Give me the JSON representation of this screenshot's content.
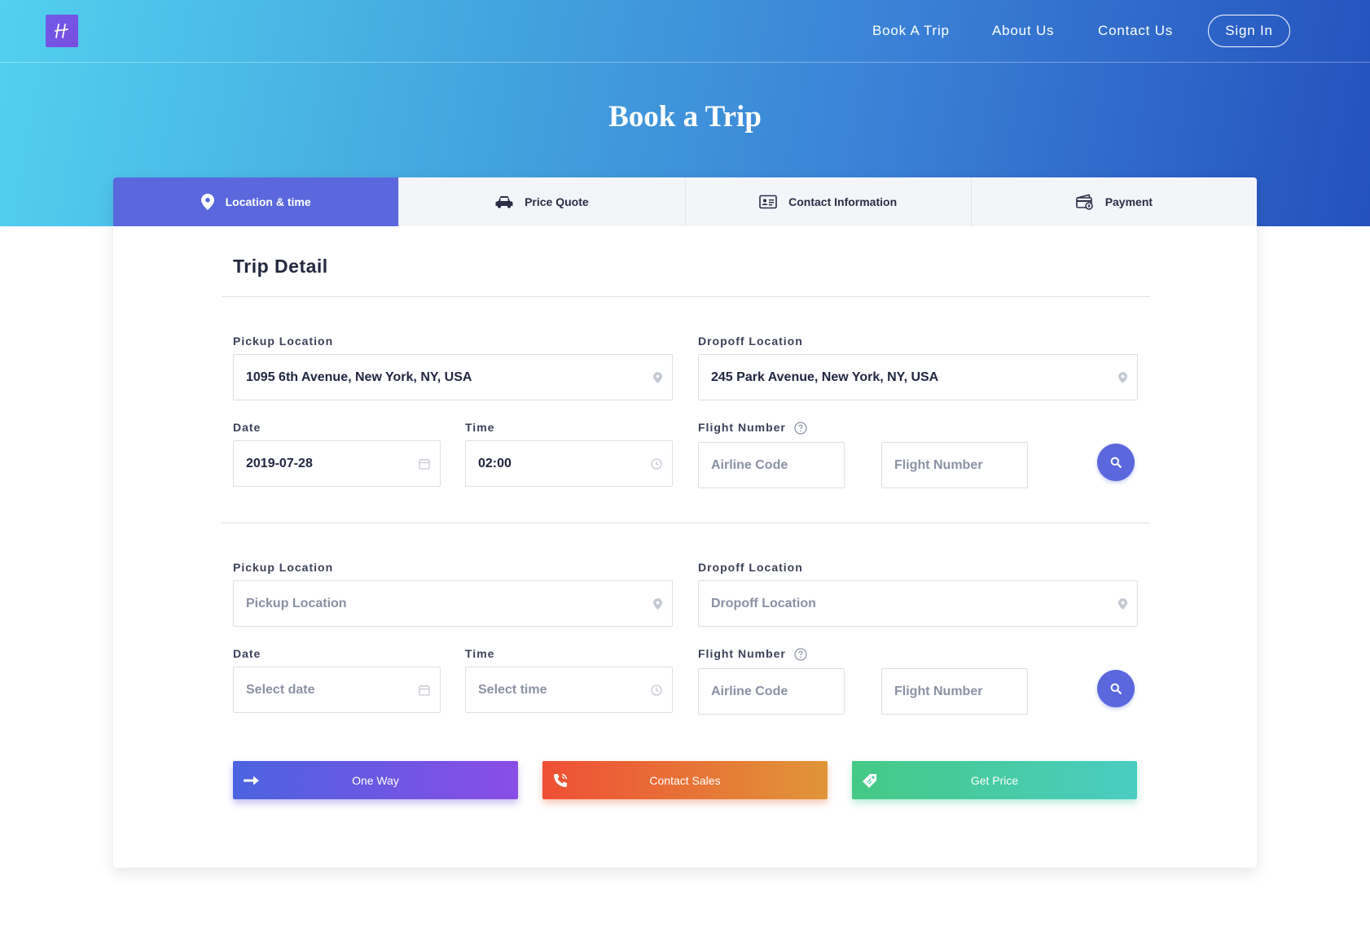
{
  "header": {
    "nav": [
      "Book A Trip",
      "About Us",
      "Contact Us"
    ],
    "sign_in": "Sign In",
    "title": "Book a Trip"
  },
  "tabs": [
    {
      "label": "Location & time",
      "icon": "map-pin-icon",
      "active": true
    },
    {
      "label": "Price Quote",
      "icon": "car-icon",
      "active": false
    },
    {
      "label": "Contact Information",
      "icon": "id-card-icon",
      "active": false
    },
    {
      "label": "Payment",
      "icon": "payment-icon",
      "active": false
    }
  ],
  "trip_detail": {
    "title": "Trip Detail",
    "legs": [
      {
        "pickup_label": "Pickup Location",
        "pickup_value": "1095 6th Avenue, New York, NY, USA",
        "dropoff_label": "Dropoff Location",
        "dropoff_value": "245 Park Avenue, New York, NY, USA",
        "date_label": "Date",
        "date_value": "2019-07-28",
        "time_label": "Time",
        "time_value": "02:00",
        "flight_label": "Flight Number",
        "airline_placeholder": "Airline Code",
        "flight_placeholder": "Flight Number"
      },
      {
        "pickup_label": "Pickup Location",
        "pickup_placeholder": "Pickup Location",
        "dropoff_label": "Dropoff Location",
        "dropoff_placeholder": "Dropoff Location",
        "date_label": "Date",
        "date_placeholder": "Select date",
        "time_label": "Time",
        "time_placeholder": "Select time",
        "flight_label": "Flight Number",
        "airline_placeholder": "Airline Code",
        "flight_placeholder": "Flight Number"
      }
    ]
  },
  "actions": {
    "one_way": "One Way",
    "contact_sales": "Contact Sales",
    "get_price": "Get Price"
  },
  "colors": {
    "accent": "#5a67dd",
    "hero_start": "#52d0ef",
    "hero_end": "#2451bd"
  }
}
